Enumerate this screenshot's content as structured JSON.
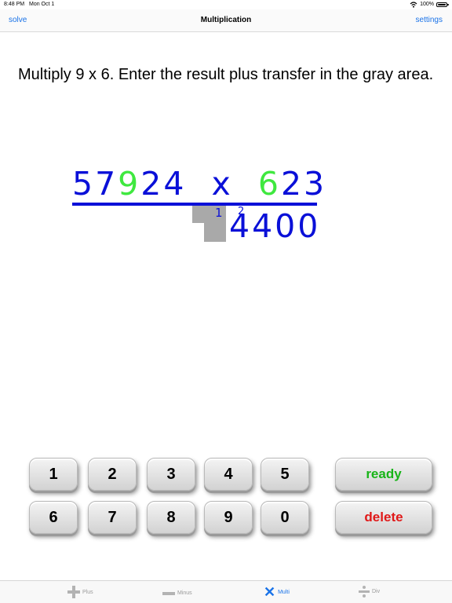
{
  "status": {
    "time": "8:48 PM",
    "date": "Mon Oct 1",
    "battery": "100%"
  },
  "nav": {
    "left": "solve",
    "title": "Multiplication",
    "right": "settings"
  },
  "instruction": "Multiply 9 x 6.  Enter the result plus transfer in the gray area.",
  "problem": {
    "multiplicand_pre": "57",
    "multiplicand_hl": "9",
    "multiplicand_post": "24",
    "operator": "x",
    "multiplier_hl": "6",
    "multiplier_post": "23",
    "carry_a": "1",
    "carry_b": "2",
    "partial_result": "4400",
    "highlight_color": "#3fe83f"
  },
  "keypad": {
    "digits": [
      "1",
      "2",
      "3",
      "4",
      "5",
      "6",
      "7",
      "8",
      "9",
      "0"
    ],
    "ready": "ready",
    "delete": "delete"
  },
  "tabs": [
    {
      "label": "Plus",
      "icon": "plus-icon"
    },
    {
      "label": "Minus",
      "icon": "minus-icon"
    },
    {
      "label": "Multi",
      "icon": "times-icon",
      "active": true
    },
    {
      "label": "Div",
      "icon": "divide-icon"
    }
  ]
}
